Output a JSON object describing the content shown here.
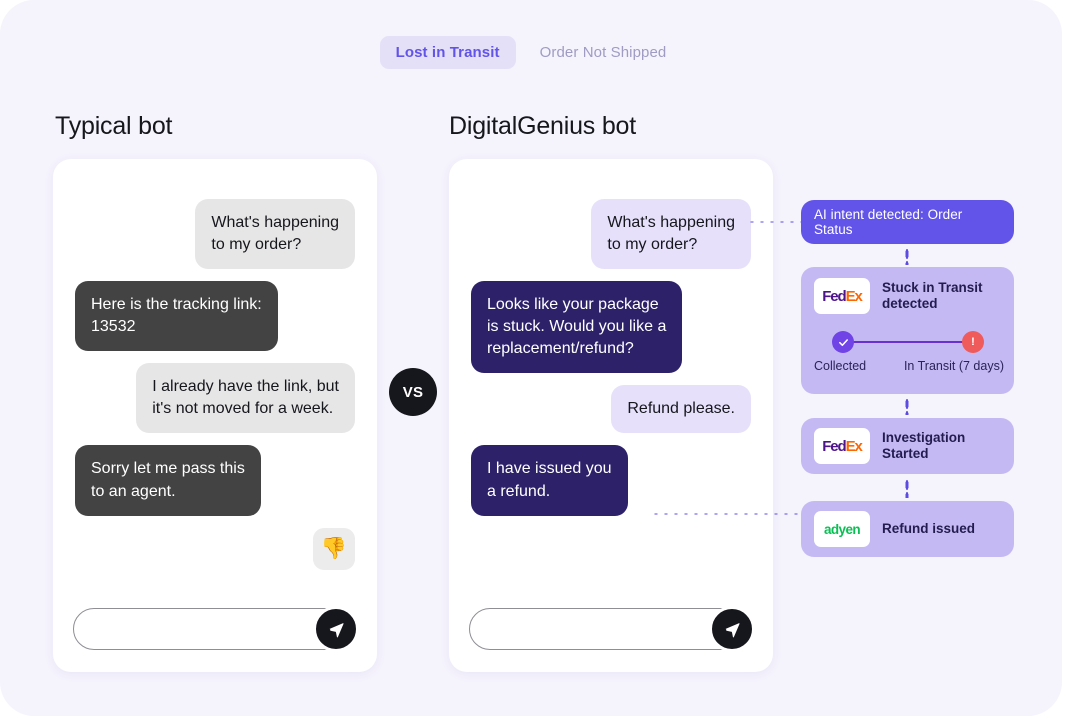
{
  "tabs": [
    {
      "label": "Lost in Transit",
      "active": true
    },
    {
      "label": "Order Not Shipped",
      "active": false
    }
  ],
  "columns": {
    "left_title": "Typical bot",
    "right_title": "DigitalGenius bot"
  },
  "vs_badge": "VS",
  "typical_bot": {
    "messages": [
      {
        "sender": "user",
        "text": "What's happening\nto my order?"
      },
      {
        "sender": "bot",
        "text": "Here is the tracking link:\n13532"
      },
      {
        "sender": "user",
        "text": "I already have the link, but\nit's not moved for a week."
      },
      {
        "sender": "bot",
        "text": "Sorry let me pass this\nto an agent."
      }
    ],
    "feedback_icon": "thumbs-down-icon",
    "feedback_glyph": "👎",
    "composer_value": "",
    "composer_placeholder": "",
    "send_icon": "send-icon"
  },
  "digitalgenius_bot": {
    "messages": [
      {
        "sender": "user",
        "text": "What's happening\nto my order?"
      },
      {
        "sender": "bot",
        "text": "Looks like your package\nis stuck. Would you like a\nreplacement/refund?"
      },
      {
        "sender": "user",
        "text": "Refund please."
      },
      {
        "sender": "bot",
        "text": "I have issued you\na refund."
      }
    ],
    "composer_value": "",
    "composer_placeholder": "",
    "send_icon": "send-icon"
  },
  "rail": {
    "intent": {
      "label": "AI intent detected: Order Status"
    },
    "stuck": {
      "logo": "fedex-logo",
      "logo_text_a": "Fed",
      "logo_text_b": "Ex",
      "title": "Stuck in Transit\ndetected",
      "steps": [
        {
          "label": "Collected",
          "state": "done",
          "icon": "check-icon"
        },
        {
          "label": "In Transit (7 days)",
          "state": "alert",
          "icon": "exclamation-icon"
        }
      ]
    },
    "investigation": {
      "logo": "fedex-logo",
      "logo_text_a": "Fed",
      "logo_text_b": "Ex",
      "title": "Investigation\nStarted"
    },
    "refund": {
      "logo": "adyen-logo",
      "logo_text": "adyen",
      "title": "Refund issued"
    }
  },
  "colors": {
    "background": "#f5f3fc",
    "accent": "#6254e8",
    "card_lilac": "#c5b9f4",
    "bot_navy": "#2d2269",
    "bot_dark": "#434343",
    "user_grey": "#e6e6e6",
    "user_lilac": "#e6e0fb",
    "alert": "#ef5b5b",
    "fedex_purple": "#4d148c",
    "fedex_orange": "#ff6600",
    "adyen_green": "#0abf53"
  }
}
